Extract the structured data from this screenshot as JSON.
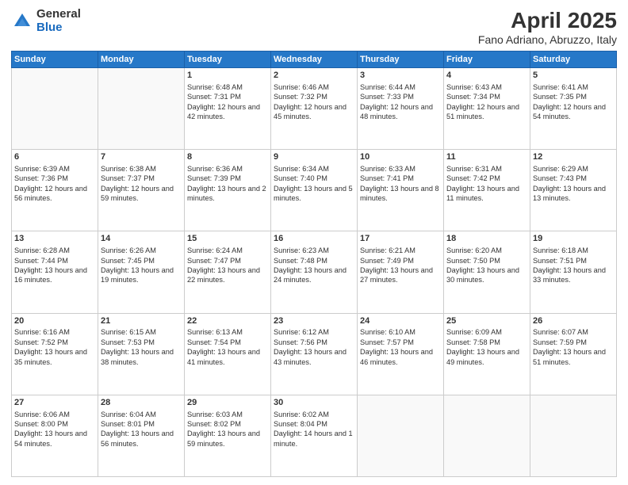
{
  "header": {
    "logo_general": "General",
    "logo_blue": "Blue",
    "month_title": "April 2025",
    "location": "Fano Adriano, Abruzzo, Italy"
  },
  "weekdays": [
    "Sunday",
    "Monday",
    "Tuesday",
    "Wednesday",
    "Thursday",
    "Friday",
    "Saturday"
  ],
  "weeks": [
    [
      {
        "day": "",
        "sunrise": "",
        "sunset": "",
        "daylight": ""
      },
      {
        "day": "",
        "sunrise": "",
        "sunset": "",
        "daylight": ""
      },
      {
        "day": "1",
        "sunrise": "Sunrise: 6:48 AM",
        "sunset": "Sunset: 7:31 PM",
        "daylight": "Daylight: 12 hours and 42 minutes."
      },
      {
        "day": "2",
        "sunrise": "Sunrise: 6:46 AM",
        "sunset": "Sunset: 7:32 PM",
        "daylight": "Daylight: 12 hours and 45 minutes."
      },
      {
        "day": "3",
        "sunrise": "Sunrise: 6:44 AM",
        "sunset": "Sunset: 7:33 PM",
        "daylight": "Daylight: 12 hours and 48 minutes."
      },
      {
        "day": "4",
        "sunrise": "Sunrise: 6:43 AM",
        "sunset": "Sunset: 7:34 PM",
        "daylight": "Daylight: 12 hours and 51 minutes."
      },
      {
        "day": "5",
        "sunrise": "Sunrise: 6:41 AM",
        "sunset": "Sunset: 7:35 PM",
        "daylight": "Daylight: 12 hours and 54 minutes."
      }
    ],
    [
      {
        "day": "6",
        "sunrise": "Sunrise: 6:39 AM",
        "sunset": "Sunset: 7:36 PM",
        "daylight": "Daylight: 12 hours and 56 minutes."
      },
      {
        "day": "7",
        "sunrise": "Sunrise: 6:38 AM",
        "sunset": "Sunset: 7:37 PM",
        "daylight": "Daylight: 12 hours and 59 minutes."
      },
      {
        "day": "8",
        "sunrise": "Sunrise: 6:36 AM",
        "sunset": "Sunset: 7:39 PM",
        "daylight": "Daylight: 13 hours and 2 minutes."
      },
      {
        "day": "9",
        "sunrise": "Sunrise: 6:34 AM",
        "sunset": "Sunset: 7:40 PM",
        "daylight": "Daylight: 13 hours and 5 minutes."
      },
      {
        "day": "10",
        "sunrise": "Sunrise: 6:33 AM",
        "sunset": "Sunset: 7:41 PM",
        "daylight": "Daylight: 13 hours and 8 minutes."
      },
      {
        "day": "11",
        "sunrise": "Sunrise: 6:31 AM",
        "sunset": "Sunset: 7:42 PM",
        "daylight": "Daylight: 13 hours and 11 minutes."
      },
      {
        "day": "12",
        "sunrise": "Sunrise: 6:29 AM",
        "sunset": "Sunset: 7:43 PM",
        "daylight": "Daylight: 13 hours and 13 minutes."
      }
    ],
    [
      {
        "day": "13",
        "sunrise": "Sunrise: 6:28 AM",
        "sunset": "Sunset: 7:44 PM",
        "daylight": "Daylight: 13 hours and 16 minutes."
      },
      {
        "day": "14",
        "sunrise": "Sunrise: 6:26 AM",
        "sunset": "Sunset: 7:45 PM",
        "daylight": "Daylight: 13 hours and 19 minutes."
      },
      {
        "day": "15",
        "sunrise": "Sunrise: 6:24 AM",
        "sunset": "Sunset: 7:47 PM",
        "daylight": "Daylight: 13 hours and 22 minutes."
      },
      {
        "day": "16",
        "sunrise": "Sunrise: 6:23 AM",
        "sunset": "Sunset: 7:48 PM",
        "daylight": "Daylight: 13 hours and 24 minutes."
      },
      {
        "day": "17",
        "sunrise": "Sunrise: 6:21 AM",
        "sunset": "Sunset: 7:49 PM",
        "daylight": "Daylight: 13 hours and 27 minutes."
      },
      {
        "day": "18",
        "sunrise": "Sunrise: 6:20 AM",
        "sunset": "Sunset: 7:50 PM",
        "daylight": "Daylight: 13 hours and 30 minutes."
      },
      {
        "day": "19",
        "sunrise": "Sunrise: 6:18 AM",
        "sunset": "Sunset: 7:51 PM",
        "daylight": "Daylight: 13 hours and 33 minutes."
      }
    ],
    [
      {
        "day": "20",
        "sunrise": "Sunrise: 6:16 AM",
        "sunset": "Sunset: 7:52 PM",
        "daylight": "Daylight: 13 hours and 35 minutes."
      },
      {
        "day": "21",
        "sunrise": "Sunrise: 6:15 AM",
        "sunset": "Sunset: 7:53 PM",
        "daylight": "Daylight: 13 hours and 38 minutes."
      },
      {
        "day": "22",
        "sunrise": "Sunrise: 6:13 AM",
        "sunset": "Sunset: 7:54 PM",
        "daylight": "Daylight: 13 hours and 41 minutes."
      },
      {
        "day": "23",
        "sunrise": "Sunrise: 6:12 AM",
        "sunset": "Sunset: 7:56 PM",
        "daylight": "Daylight: 13 hours and 43 minutes."
      },
      {
        "day": "24",
        "sunrise": "Sunrise: 6:10 AM",
        "sunset": "Sunset: 7:57 PM",
        "daylight": "Daylight: 13 hours and 46 minutes."
      },
      {
        "day": "25",
        "sunrise": "Sunrise: 6:09 AM",
        "sunset": "Sunset: 7:58 PM",
        "daylight": "Daylight: 13 hours and 49 minutes."
      },
      {
        "day": "26",
        "sunrise": "Sunrise: 6:07 AM",
        "sunset": "Sunset: 7:59 PM",
        "daylight": "Daylight: 13 hours and 51 minutes."
      }
    ],
    [
      {
        "day": "27",
        "sunrise": "Sunrise: 6:06 AM",
        "sunset": "Sunset: 8:00 PM",
        "daylight": "Daylight: 13 hours and 54 minutes."
      },
      {
        "day": "28",
        "sunrise": "Sunrise: 6:04 AM",
        "sunset": "Sunset: 8:01 PM",
        "daylight": "Daylight: 13 hours and 56 minutes."
      },
      {
        "day": "29",
        "sunrise": "Sunrise: 6:03 AM",
        "sunset": "Sunset: 8:02 PM",
        "daylight": "Daylight: 13 hours and 59 minutes."
      },
      {
        "day": "30",
        "sunrise": "Sunrise: 6:02 AM",
        "sunset": "Sunset: 8:04 PM",
        "daylight": "Daylight: 14 hours and 1 minute."
      },
      {
        "day": "",
        "sunrise": "",
        "sunset": "",
        "daylight": ""
      },
      {
        "day": "",
        "sunrise": "",
        "sunset": "",
        "daylight": ""
      },
      {
        "day": "",
        "sunrise": "",
        "sunset": "",
        "daylight": ""
      }
    ]
  ]
}
